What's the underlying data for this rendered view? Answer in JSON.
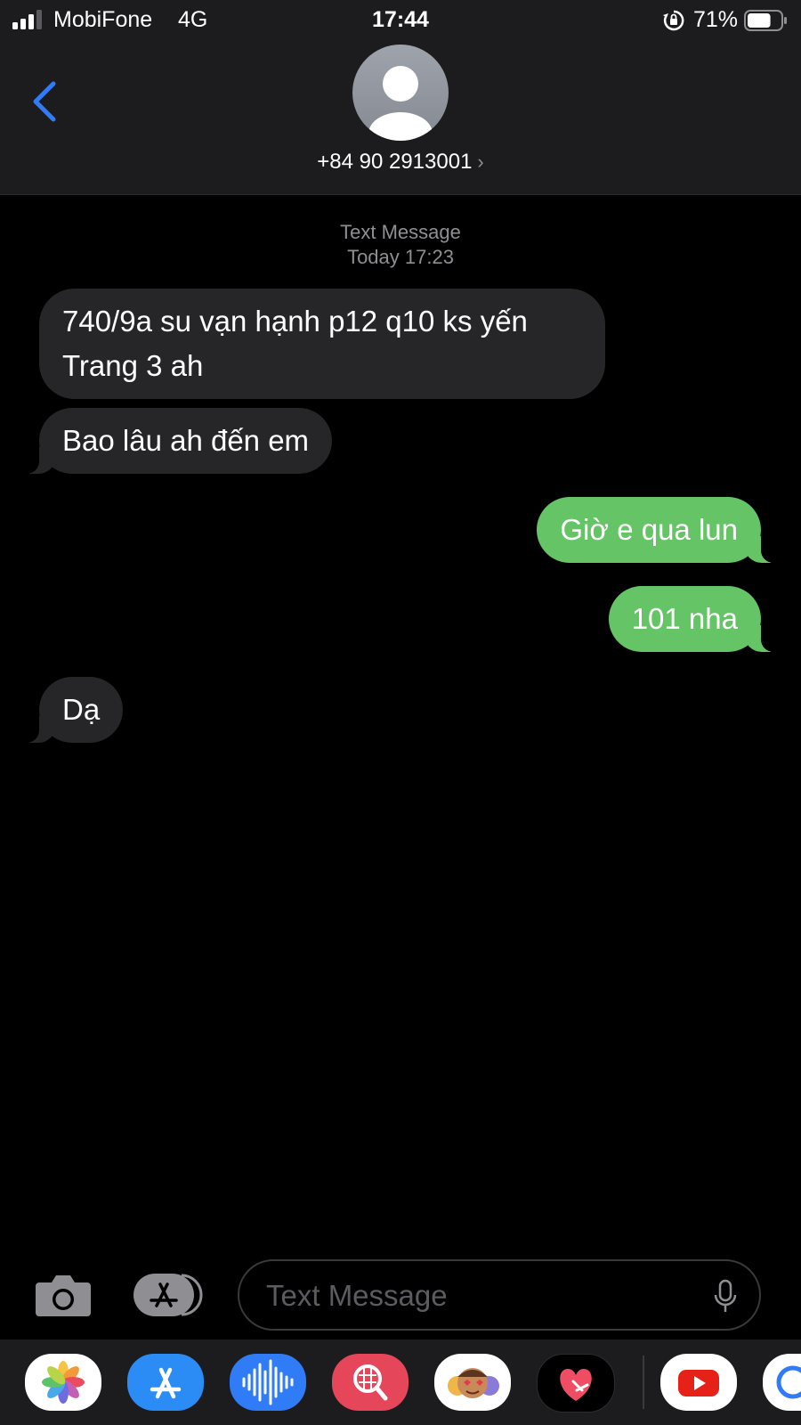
{
  "status": {
    "carrier": "MobiFone",
    "network": "4G",
    "time": "17:44",
    "battery_percent": "71%",
    "battery_level": 0.71
  },
  "header": {
    "contact": "+84 90 2913001",
    "chevron": "›"
  },
  "thread": {
    "kind": "Text Message",
    "timestamp": "Today 17:23",
    "messages": [
      {
        "from": "them",
        "text": "740/9a su vạn hạnh p12 q10 ks yến Trang 3 ah"
      },
      {
        "from": "them",
        "text": "Bao lâu ah đến em"
      },
      {
        "from": "me",
        "text": "Giờ e qua lun"
      },
      {
        "from": "me",
        "text": "101 nha"
      },
      {
        "from": "them",
        "text": "Dạ"
      }
    ]
  },
  "compose": {
    "placeholder": "Text Message"
  },
  "drawer": {
    "apps": [
      "photos-icon",
      "app-store-icon",
      "audio-messages-icon",
      "images-search-icon",
      "memoji-icon",
      "digital-touch-icon",
      "youtube-icon",
      "partial-app-icon"
    ]
  },
  "colors": {
    "incoming": "#262628",
    "outgoing": "#65c466",
    "accent": "#2f7cf6"
  }
}
